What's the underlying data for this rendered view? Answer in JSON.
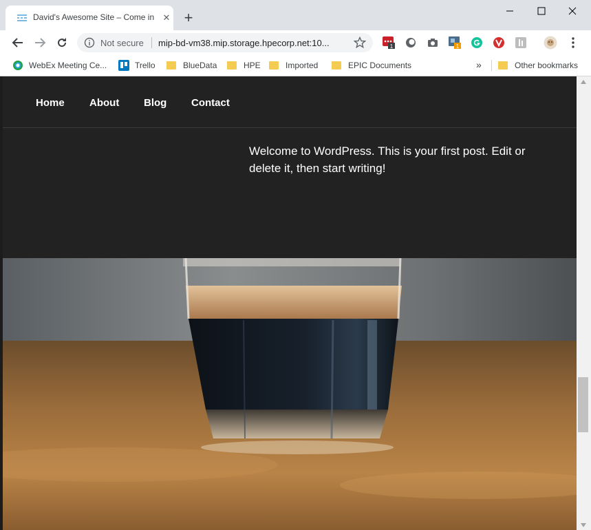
{
  "tab": {
    "title": "David's Awesome Site – Come in"
  },
  "toolbar": {
    "security_label": "Not secure",
    "url": "mip-bd-vm38.mip.storage.hpecorp.net:10..."
  },
  "extensions": [
    {
      "name": "lastpass-icon",
      "badge": "1"
    },
    {
      "name": "circle-extension-icon"
    },
    {
      "name": "camera-icon"
    },
    {
      "name": "tab-manager-icon",
      "badge": "1"
    },
    {
      "name": "grammarly-icon"
    },
    {
      "name": "red-v-extension-icon"
    },
    {
      "name": "puzzle-extension-icon"
    },
    {
      "name": "profile-avatar-icon"
    }
  ],
  "bookmarks": {
    "items": [
      {
        "label": "WebEx Meeting Ce...",
        "icon": "webex-icon"
      },
      {
        "label": "Trello",
        "icon": "trello-icon"
      },
      {
        "label": "BlueData",
        "icon": "folder-icon"
      },
      {
        "label": "HPE",
        "icon": "folder-icon"
      },
      {
        "label": "Imported",
        "icon": "folder-icon"
      },
      {
        "label": "EPIC Documents",
        "icon": "folder-icon"
      }
    ],
    "overflow": "»",
    "other": "Other bookmarks"
  },
  "site": {
    "nav": [
      "Home",
      "About",
      "Blog",
      "Contact"
    ],
    "post_text": "Welcome to WordPress. This is your first post. Edit or delete it, then start writing!"
  },
  "colors": {
    "page_background": "#222222",
    "tabstrip": "#dee1e6",
    "folder": "#f4cc52"
  }
}
